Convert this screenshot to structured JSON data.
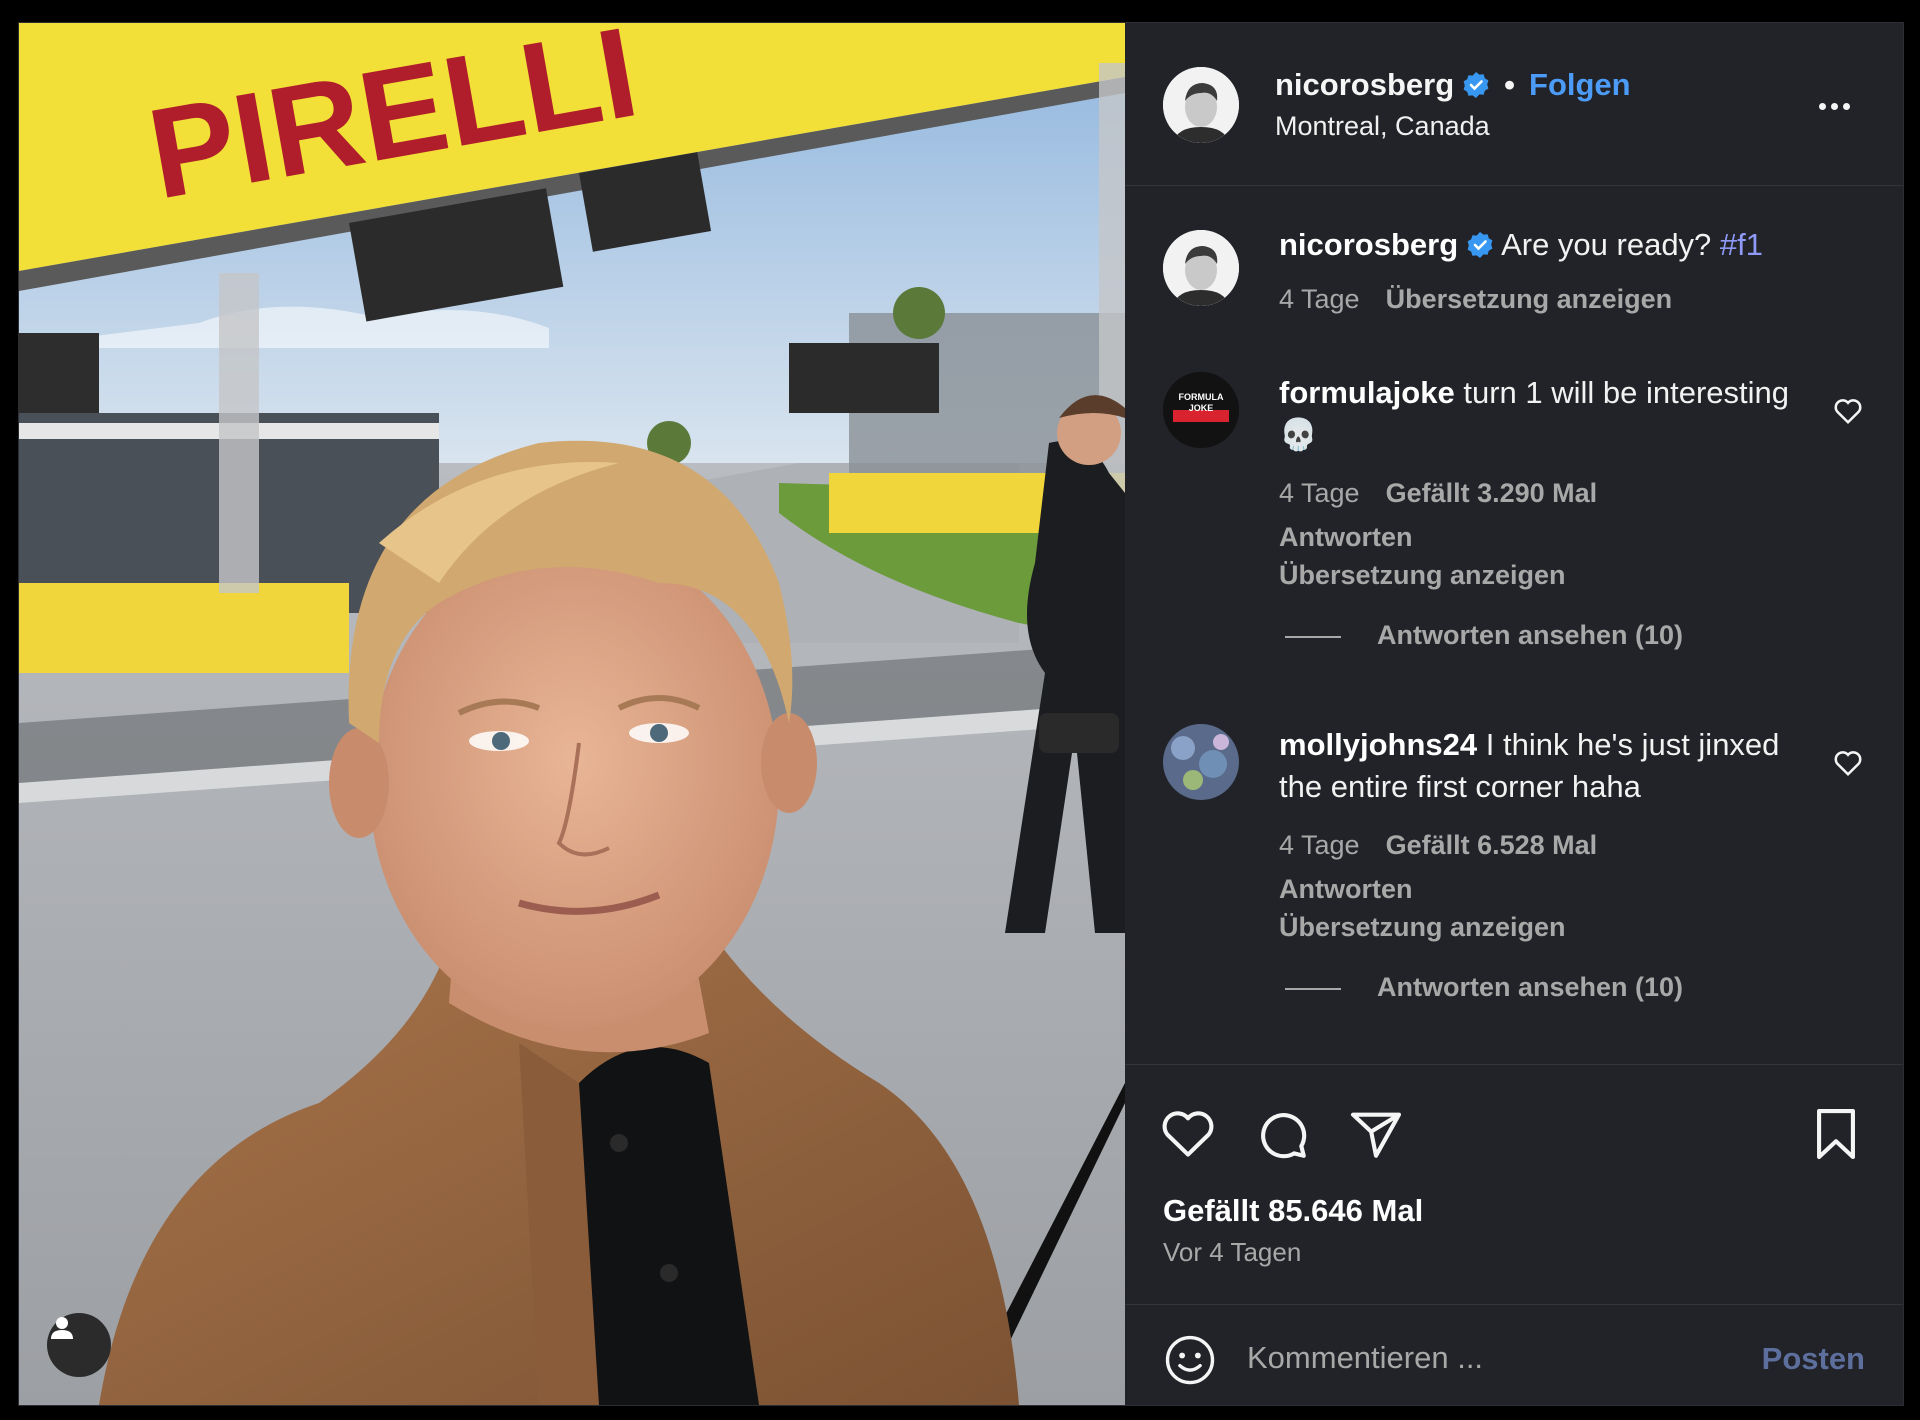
{
  "post": {
    "username": "nicorosberg",
    "separator": "•",
    "follow_label": "Folgen",
    "location": "Montreal, Canada",
    "more_icon": "more-horizontal-icon"
  },
  "photo": {
    "banner_text": "PIRELLI",
    "board_text": "PIRELLI",
    "tag_icon": "user-icon"
  },
  "caption": {
    "username": "nicorosberg",
    "text": "Are you ready?",
    "hashtag": "#f1",
    "age": "4 Tage",
    "translate": "Übersetzung anzeigen"
  },
  "comments": [
    {
      "username": "formulajoke",
      "text": "turn 1 will be interesting 💀",
      "avatar_text": "FORMULA JOKE",
      "age": "4 Tage",
      "likes": "Gefällt 3.290 Mal",
      "reply": "Antworten",
      "translate": "Übersetzung anzeigen",
      "view_replies": "Antworten ansehen (10)"
    },
    {
      "username": "mollyjohns24",
      "text": "I think he's just jinxed the entire first corner haha",
      "age": "4 Tage",
      "likes": "Gefällt 6.528 Mal",
      "reply": "Antworten",
      "translate": "Übersetzung anzeigen",
      "view_replies": "Antworten ansehen (10)"
    }
  ],
  "footer": {
    "likes": "Gefällt 85.646 Mal",
    "time": "Vor 4 Tagen",
    "comment_placeholder": "Kommentieren ...",
    "post_label": "Posten"
  },
  "colors": {
    "panel_bg": "#212328",
    "link_blue": "#4c9bf7",
    "hashtag": "#8f9af8",
    "muted": "#a8a8a8",
    "pirelli_yellow": "#f2df37",
    "pirelli_red": "#b01e2c"
  }
}
